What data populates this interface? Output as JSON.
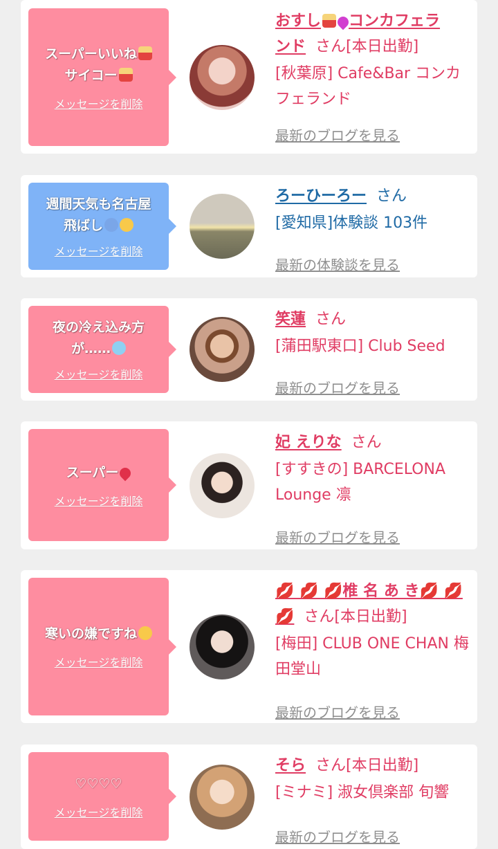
{
  "colors": {
    "background": "#efefef",
    "bubble_pink": "#fe8da0",
    "bubble_blue": "#7fb3f7",
    "name_pink": "#e03c63",
    "name_blue": "#1f6aa5",
    "link_gray": "#8f8f8f"
  },
  "delete_label": "メッセージを削除",
  "cards": [
    {
      "message_line1": "スーパーいいね",
      "message_line2": "サイコー",
      "delete_label": "メッセージを削除",
      "name_part1": "おすし",
      "name_part2": "コンカフェラ",
      "name_part3": "ンド",
      "suffix": "さん[本日出勤]",
      "shop": "[秋葉原] Cafe&Bar コンカフェランド",
      "link": "最新のブログを見る"
    },
    {
      "message_line1": "週間天気も名古屋",
      "message_line2": "飛ばし",
      "delete_label": "メッセージを削除",
      "name": "ろーひーろー",
      "suffix": "さん",
      "shop": "[愛知県]体験談 103件",
      "link": "最新の体験談を見る"
    },
    {
      "message_line1": "夜の冷え込み方",
      "message_line2": "が……",
      "delete_label": "メッセージを削除",
      "name": "笑蓮",
      "suffix": "さん",
      "shop": "[蒲田駅東口] Club Seed",
      "link": "最新のブログを見る"
    },
    {
      "message_line1": "スーパー",
      "delete_label": "メッセージを削除",
      "name": "妃 えりな",
      "suffix": "さん",
      "shop": "[すすきの] BARCELONA Lounge 凛",
      "link": "最新のブログを見る"
    },
    {
      "message_line1": "寒いの嫌ですね",
      "delete_label": "メッセージを削除",
      "name_lips_prefix": "💋 💋 💋",
      "name": "椎 名 あ き",
      "name_lips_suffix": "💋 💋",
      "name_lips_line2": "💋",
      "suffix": "さん[本日出勤]",
      "shop": "[梅田] CLUB ONE CHAN 梅田堂山",
      "link": "最新のブログを見る"
    },
    {
      "message_line1": "♡♡♡♡",
      "delete_label": "メッセージを削除",
      "name": "そら",
      "suffix": "さん[本日出勤]",
      "shop": "[ミナミ] 淑女倶楽部 旬響",
      "link": "最新のブログを見る"
    }
  ]
}
